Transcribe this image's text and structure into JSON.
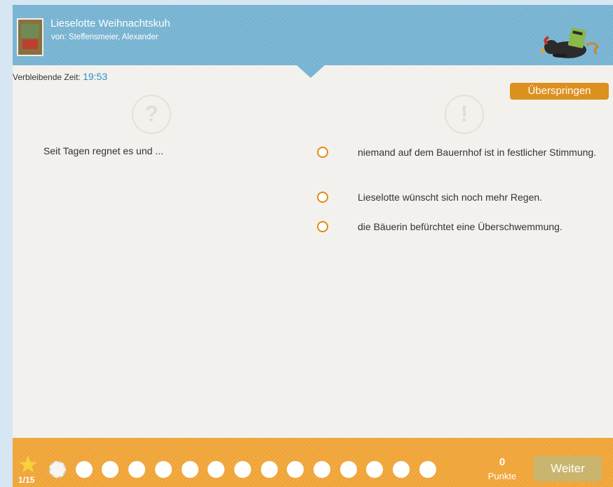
{
  "book": {
    "title": "Lieselotte Weihnachtskuh",
    "author": "von: Steffensmeier, Alexander"
  },
  "timer": {
    "label": "Verbleibende Zeit:",
    "value": "19:53"
  },
  "skip_label": "Überspringen",
  "question_icon": "?",
  "answer_icon": "!",
  "question": "Seit Tagen regnet es und ...",
  "answers": [
    "niemand auf dem Bauernhof ist in festlicher Stimmung.",
    "Lieselotte wünscht sich noch mehr Regen.",
    "die Bäuerin befürchtet eine Überschwemmung."
  ],
  "progress": {
    "count": "1/15",
    "current": 1,
    "total": 15
  },
  "score": {
    "value": "0",
    "label": "Punkte"
  },
  "next_label": "Weiter",
  "colors": {
    "header": "#78b5d4",
    "footer": "#f2a638",
    "accent": "#dc901e",
    "timer": "#2a8fc8",
    "next_button": "#c9b56d"
  },
  "icons": [
    "book-cover-icon",
    "raven-mascot-icon",
    "question-mark-icon",
    "exclamation-icon",
    "star-icon"
  ]
}
